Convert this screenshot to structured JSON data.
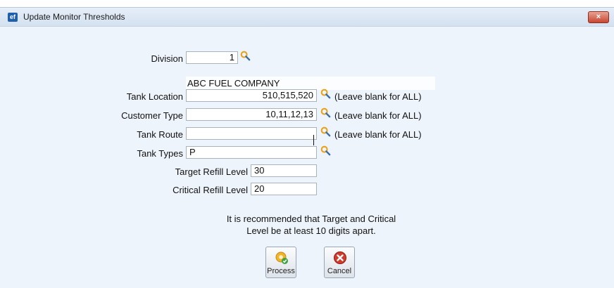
{
  "window": {
    "title": "Update Monitor Thresholds",
    "app_icon_text": "ef",
    "close_label": "×"
  },
  "form": {
    "division": {
      "label": "Division",
      "value": "1"
    },
    "company_name": "ABC FUEL COMPANY",
    "tank_location": {
      "label": "Tank Location",
      "value": "510,515,520",
      "hint": "(Leave blank for ALL)"
    },
    "customer_type": {
      "label": "Customer Type",
      "value": "10,11,12,13",
      "hint": "(Leave blank for ALL)"
    },
    "tank_route": {
      "label": "Tank Route",
      "value": "",
      "hint": "(Leave blank for ALL)"
    },
    "tank_types": {
      "label": "Tank Types",
      "value": "P"
    },
    "target_refill": {
      "label": "Target Refill Level",
      "value": "30"
    },
    "critical_refill": {
      "label": "Critical Refill Level",
      "value": "20"
    }
  },
  "note": {
    "line1": "It is recommended that Target and Critical",
    "line2": "Level be at least 10 digits apart."
  },
  "buttons": {
    "process": "Process",
    "cancel": "Cancel"
  },
  "colors": {
    "window_bg": "#eef4fb",
    "titlebar": "#dce7f3",
    "close": "#c9462f",
    "search_icon": "#e8a317"
  }
}
